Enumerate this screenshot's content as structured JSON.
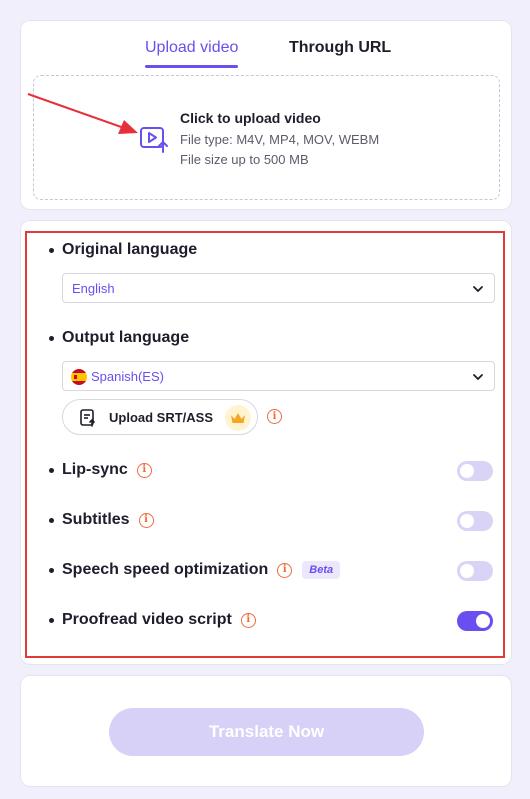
{
  "tabs": [
    {
      "label": "Upload video",
      "active": true
    },
    {
      "label": "Through URL",
      "active": false
    }
  ],
  "upload": {
    "title": "Click to upload video",
    "file_type": "File type: M4V, MP4, MOV, WEBM",
    "file_size": "File size up to 500 MB",
    "icon": "video-upload-icon"
  },
  "original_language": {
    "label": "Original language",
    "value": "English"
  },
  "output_language": {
    "label": "Output language",
    "value": "Spanish(ES)",
    "flag": "spain-flag-icon"
  },
  "upload_srt": {
    "label": "Upload SRT/ASS",
    "badge": "crown-icon"
  },
  "options": [
    {
      "label": "Lip-sync",
      "enabled": false
    },
    {
      "label": "Subtitles",
      "enabled": false
    },
    {
      "label": "Speech speed optimization",
      "badge": "Beta",
      "enabled": false
    },
    {
      "label": "Proofread video script",
      "enabled": true
    }
  ],
  "translate_button": "Translate Now",
  "colors": {
    "accent": "#6b4ef0",
    "info": "#f06b3c",
    "highlight_border": "#e23a3a",
    "arrow": "#e8303a"
  }
}
